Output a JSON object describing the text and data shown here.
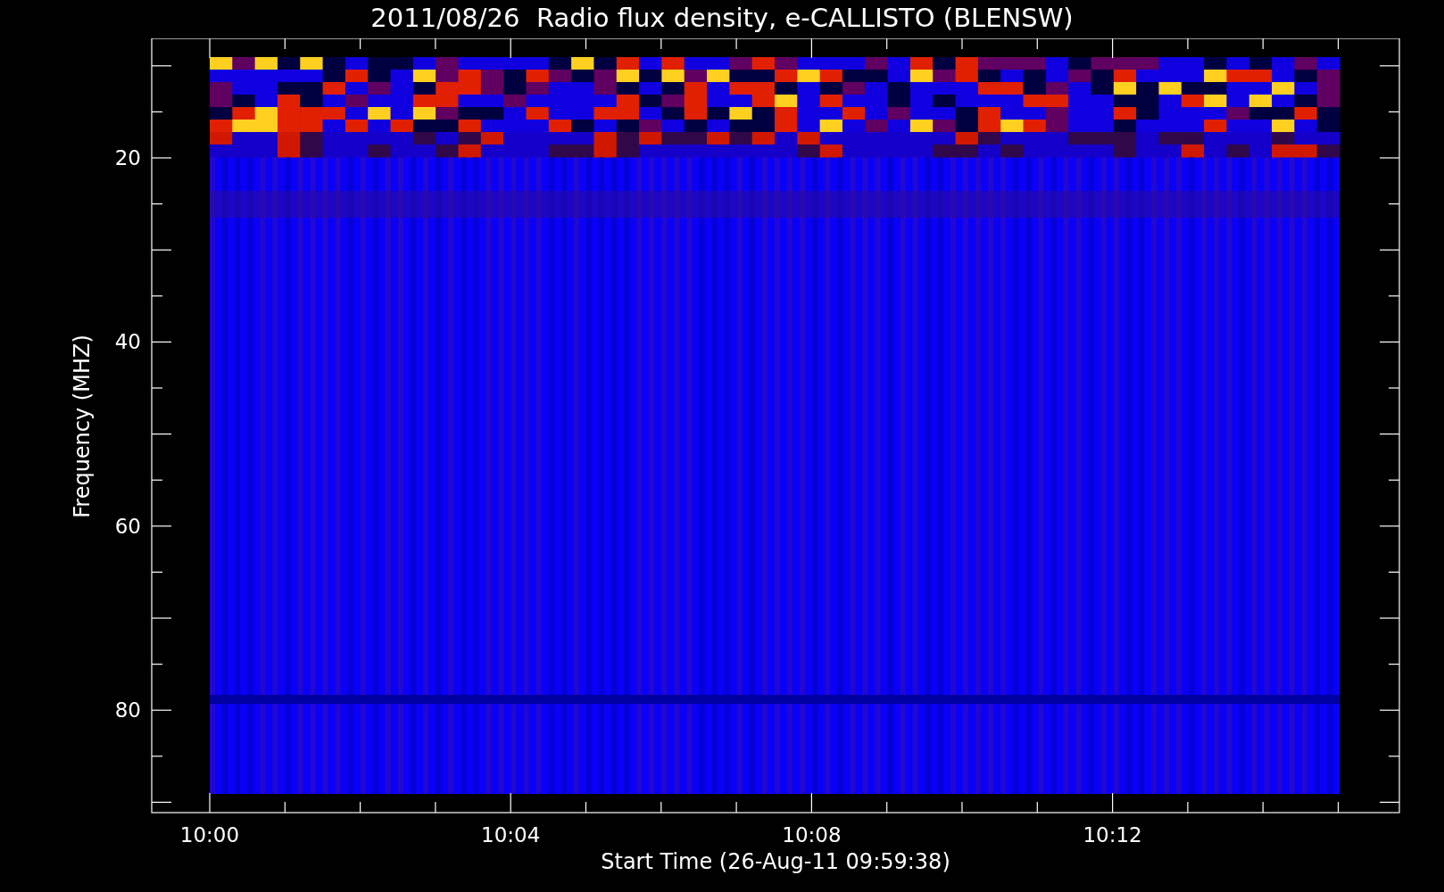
{
  "title": "2011/08/26  Radio flux density, e-CALLISTO (BLENSW)",
  "y_axis": {
    "label": "Frequency (MHZ)",
    "ticks": [
      "20",
      "40",
      "60",
      "80"
    ]
  },
  "x_axis": {
    "label": "Start Time (26-Aug-11 09:59:38)",
    "ticks": [
      "10:00",
      "10:04",
      "10:08",
      "10:12"
    ]
  }
}
